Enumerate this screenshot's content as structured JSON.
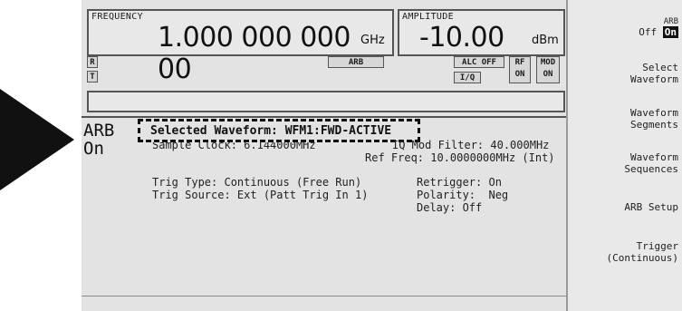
{
  "frequency": {
    "label": "FREQUENCY",
    "value": "1.000 000 000 00",
    "unit": "GHz"
  },
  "amplitude": {
    "label": "AMPLITUDE",
    "value": "-10.00",
    "unit": "dBm"
  },
  "status": {
    "r": "R",
    "t": "T",
    "arb": "ARB",
    "alc": "ALC OFF",
    "iq": "I/Q",
    "rf_on": "RF\nON",
    "mod_on": "MOD\nON"
  },
  "arb_state": {
    "line1": "ARB",
    "line2": "On"
  },
  "selected_waveform": "Selected Waveform: WFM1:FWD-ACTIVE",
  "info": {
    "sample_clock": "Sample Clock: 6.144000MHz",
    "iq_filter": "IQ Mod Filter: 40.000MHz",
    "ref_freq": "Ref Freq: 10.0000000MHz (Int)",
    "trig_type": "Trig Type: Continuous (Free Run)",
    "trig_source": "Trig Source: Ext (Patt Trig In 1)",
    "retrigger": "Retrigger: On",
    "polarity": "Polarity:  Neg",
    "delay": "Delay: Off"
  },
  "softkeys": {
    "arb_top": "ARB",
    "arb_off": "Off",
    "arb_on": "On",
    "select_waveform_1": "Select",
    "select_waveform_2": "Waveform",
    "waveform_segments_1": "Waveform",
    "waveform_segments_2": "Segments",
    "waveform_sequences_1": "Waveform",
    "waveform_sequences_2": "Sequences",
    "arb_setup": "ARB Setup",
    "trigger_1": "Trigger",
    "trigger_2": "(Continuous)"
  }
}
